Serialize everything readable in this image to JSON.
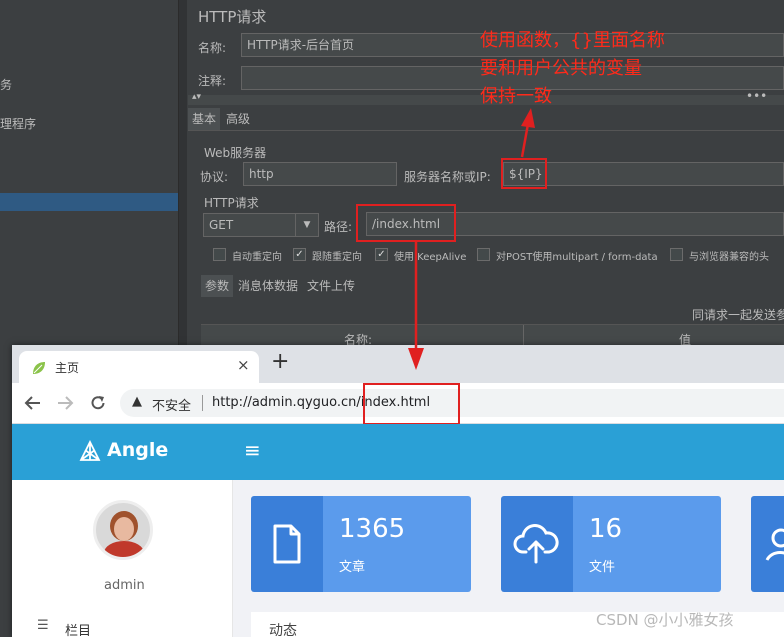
{
  "jmeter": {
    "left_fragments": [
      "务",
      "理程序"
    ],
    "title": "HTTP请求",
    "name_label": "名称:",
    "name_value": "HTTP请求-后台首页",
    "comment_label": "注释:",
    "comment_value": "",
    "tabs": [
      "基本",
      "高级"
    ],
    "web_server_label": "Web服务器",
    "protocol_label": "协议:",
    "protocol_value": "http",
    "server_label": "服务器名称或IP:",
    "server_value": "${IP}",
    "http_request_label": "HTTP请求",
    "method_value": "GET",
    "path_label": "路径:",
    "path_value": "/index.html",
    "checkboxes": [
      {
        "label": "自动重定向",
        "checked": false
      },
      {
        "label": "跟随重定向",
        "checked": true
      },
      {
        "label": "使用 KeepAlive",
        "checked": true
      },
      {
        "label": "对POST使用multipart / form-data",
        "checked": false
      },
      {
        "label": "与浏览器兼容的头",
        "checked": false
      }
    ],
    "param_tabs": [
      "参数",
      "消息体数据",
      "文件上传"
    ],
    "send_with_request": "同请求一起发送参",
    "table_headers": [
      "名称:",
      "值"
    ],
    "annotation_lines": [
      "使用函数，{}里面名称",
      "要和用户公共的变量",
      "保持一致"
    ]
  },
  "browser": {
    "tab_title": "主页",
    "tab_close": "×",
    "new_tab": "+",
    "insecure_label": "不安全",
    "url": "http://admin.qyguo.cn/index.html",
    "brand": "Angle",
    "user_name": "admin",
    "nav_item": "栏目",
    "cards": [
      {
        "value": "1365",
        "label": "文章",
        "icon": "file-icon"
      },
      {
        "value": "16",
        "label": "文件",
        "icon": "cloud-upload-icon"
      }
    ],
    "panel_title": "动态"
  },
  "watermark": "CSDN @小小雅女孩",
  "colors": {
    "jmeter_bg": "#3c3f41",
    "annotation_red": "#e02020",
    "appbar_blue": "#2aa0d6",
    "card_icon_blue": "#3a7fd9",
    "card_body_blue": "#5b9bec"
  }
}
